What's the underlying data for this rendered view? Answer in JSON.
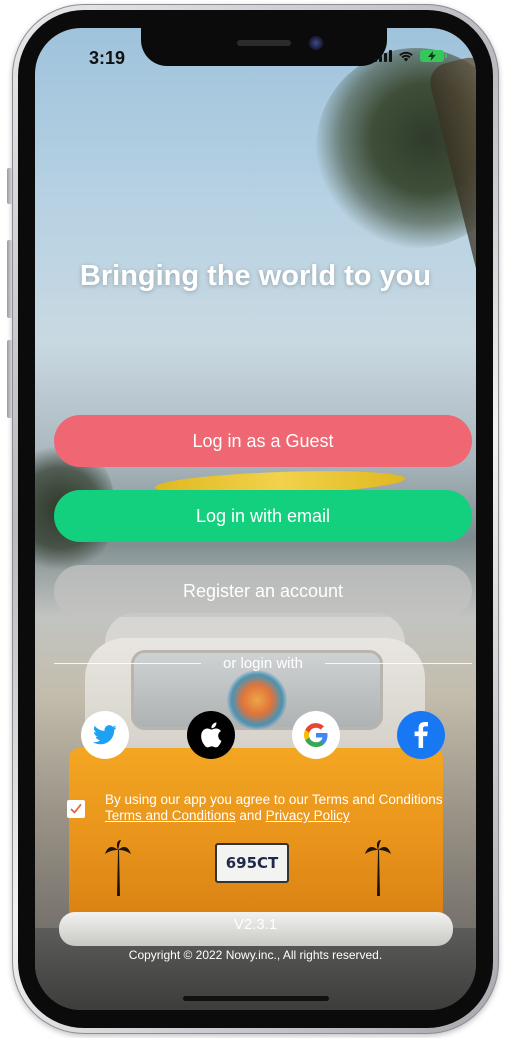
{
  "status_bar": {
    "time": "3:19"
  },
  "hero": {
    "headline": "Bringing the world to you",
    "plate_text": "695CT"
  },
  "buttons": {
    "guest_label": "Log in as a Guest",
    "email_label": "Log in with email",
    "register_label": "Register an account"
  },
  "social_login": {
    "divider_label": "or login with",
    "providers": [
      {
        "name": "Twitter",
        "icon": "twitter-icon",
        "color": "#1da1f2"
      },
      {
        "name": "Apple",
        "icon": "apple-icon",
        "color": "#000000"
      },
      {
        "name": "Google",
        "icon": "google-icon",
        "color": "#ffffff"
      },
      {
        "name": "Facebook",
        "icon": "facebook-icon",
        "color": "#1877f2"
      }
    ]
  },
  "terms": {
    "checked": true,
    "sentence": "By using our app you agree to our Terms and Conditions",
    "terms_link": "Terms and Conditions",
    "and_text": "and",
    "privacy_link": "Privacy Policy"
  },
  "footer": {
    "version": "V2.3.1",
    "copyright": "Copyright © 2022 Nowy.inc., All rights reserved."
  },
  "colors": {
    "guest_button": "#ee6773",
    "email_button": "#13d07e",
    "register_button": "#c4c4c2",
    "battery": "#35c759"
  }
}
